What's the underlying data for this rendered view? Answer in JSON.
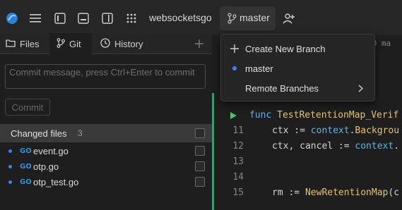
{
  "topbar": {
    "project_name": "websocketsgo",
    "branch_name": "master"
  },
  "tabs": [
    {
      "label": "Files",
      "icon": "folder-icon"
    },
    {
      "label": "Git",
      "icon": "git-branch-icon"
    },
    {
      "label": "History",
      "icon": "clock-icon"
    }
  ],
  "commit": {
    "placeholder": "Commit message, press Ctrl+Enter to commit",
    "button_label": "Commit"
  },
  "changes": {
    "header": "Changed files",
    "count": "3",
    "files": [
      {
        "badge": "GO",
        "name": "event.go"
      },
      {
        "badge": "GO",
        "name": "otp.go"
      },
      {
        "badge": "GO",
        "name": "otp_test.go"
      }
    ]
  },
  "editor": {
    "tab_hint": "GO ma",
    "lines": [
      {
        "num": "",
        "code": "func TestRetentionMap_Verif"
      },
      {
        "num": "11",
        "code": "ctx := context.Backgrou"
      },
      {
        "num": "12",
        "code": "ctx, cancel := context."
      },
      {
        "num": "13",
        "code": ""
      },
      {
        "num": "14",
        "code": ""
      },
      {
        "num": "15",
        "code": "rm := NewRetentionMap(c"
      }
    ]
  },
  "dropdown": {
    "items": [
      {
        "label": "Create New Branch",
        "icon": "plus-icon"
      },
      {
        "label": "master",
        "icon": "current-branch-dot-icon"
      },
      {
        "label": "Remote Branches",
        "icon": "chevron-right-icon"
      }
    ]
  },
  "colors": {
    "accent_blue": "#3b82f6",
    "go_badge": "#3b8fd6",
    "gutter_green": "#3a9a70",
    "run_green": "#4ec07a"
  }
}
